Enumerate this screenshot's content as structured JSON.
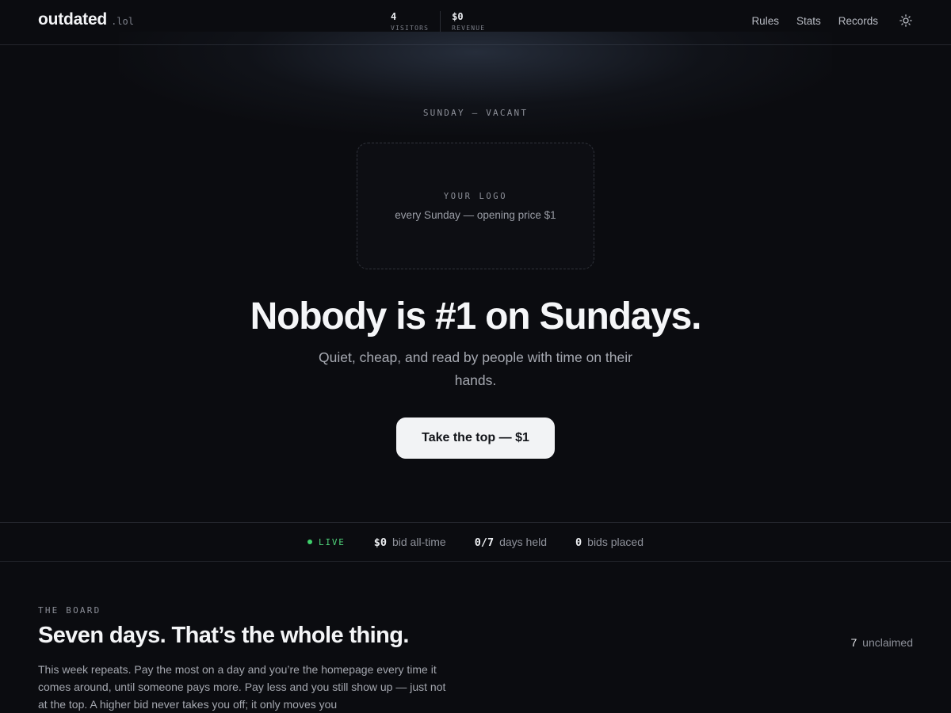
{
  "header": {
    "brand_name": "outdated",
    "brand_tld": ".lol",
    "stats": [
      {
        "value": "4",
        "label": "VISITORS"
      },
      {
        "value": "$0",
        "label": "REVENUE"
      }
    ],
    "nav": [
      "Rules",
      "Stats",
      "Records"
    ],
    "theme_toggle_icon": "sun-icon"
  },
  "hero": {
    "eyebrow": "SUNDAY — VACANT",
    "logo_slot": {
      "title": "YOUR LOGO",
      "subtitle": "every Sunday — opening price $1"
    },
    "title": "Nobody is #1 on Sundays.",
    "subtitle": "Quiet, cheap, and read by people with time on their hands.",
    "cta_label": "Take the top — $1"
  },
  "livebar": {
    "status_label": "LIVE",
    "status_color": "#3ecf6b",
    "metrics": [
      {
        "value": "$0",
        "label": "bid all-time"
      },
      {
        "value": "0/7",
        "label": "days held"
      },
      {
        "value": "0",
        "label": "bids placed"
      }
    ]
  },
  "board": {
    "eyebrow": "THE BOARD",
    "title": "Seven days. That’s the whole thing.",
    "count_value": "7",
    "count_label": "unclaimed",
    "body": "This week repeats. Pay the most on a day and you’re the homepage every time it comes around, until someone pays more. Pay less and you still show up — just not at the top. A higher bid never takes you off; it only moves you"
  }
}
